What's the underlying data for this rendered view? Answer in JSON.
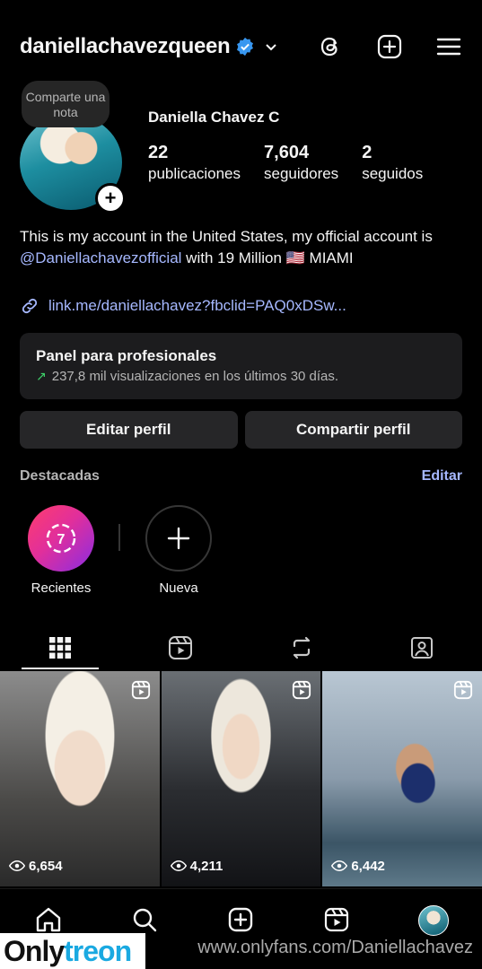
{
  "header": {
    "username": "daniellachavezqueen",
    "icons": [
      "verified-badge",
      "chevron-down-icon",
      "threads-icon",
      "create-icon",
      "menu-icon"
    ]
  },
  "profile": {
    "note": "Comparte una nota",
    "display_name": "Daniella Chavez C",
    "stats": [
      {
        "value": "22",
        "label": "publicaciones"
      },
      {
        "value": "7,604",
        "label": "seguidores"
      },
      {
        "value": "2",
        "label": "seguidos"
      }
    ],
    "bio_pre": "This is my account in the United States, my official account is ",
    "bio_mention": "@Daniellachavezofficial",
    "bio_post": " with 19 Million 🇺🇸 MIAMI",
    "link": "link.me/daniellachavez?fbclid=PAQ0xDSw..."
  },
  "panel": {
    "title": "Panel para profesionales",
    "subtitle": "237,8 mil visualizaciones en los últimos 30 días."
  },
  "buttons": {
    "edit": "Editar perfil",
    "share": "Compartir perfil"
  },
  "highlights": {
    "title": "Destacadas",
    "edit": "Editar",
    "items": [
      {
        "label": "Recientes",
        "badge": "7"
      },
      {
        "label": "Nueva"
      }
    ]
  },
  "tabs": [
    "grid-icon",
    "reels-icon",
    "reposts-icon",
    "tagged-icon"
  ],
  "posts": [
    {
      "views": "6,654",
      "type": "reel"
    },
    {
      "views": "4,211",
      "type": "reel"
    },
    {
      "views": "6,442",
      "type": "reel"
    }
  ],
  "bottom_nav": [
    "home-icon",
    "search-icon",
    "create-icon",
    "reels-icon",
    "profile-avatar"
  ],
  "watermark": {
    "logo_a": "Only",
    "logo_b": "treon",
    "url": "www.onlyfans.com/Daniellachavez"
  }
}
